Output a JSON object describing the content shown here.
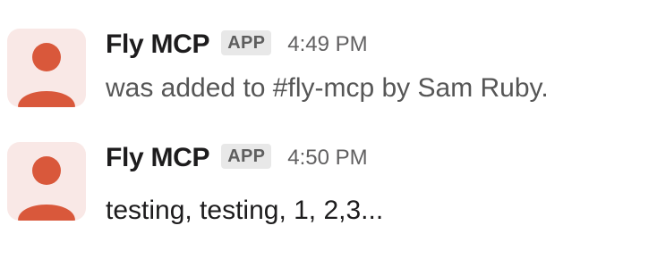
{
  "messages": [
    {
      "sender": "Fly MCP",
      "badge": "APP",
      "time": "4:49 PM",
      "text": "was added to #fly-mcp by Sam Ruby.",
      "avatar_icon": "person-icon"
    },
    {
      "sender": "Fly MCP",
      "badge": "APP",
      "time": "4:50 PM",
      "text": "testing, testing, 1, 2,3...",
      "avatar_icon": "person-icon"
    }
  ],
  "colors": {
    "avatar_bg": "#f9e8e6",
    "avatar_fg": "#d9583b",
    "badge_bg": "#e8e8e8",
    "badge_text": "#5e5e5e",
    "name": "#1d1c1d",
    "meta": "#616061"
  }
}
